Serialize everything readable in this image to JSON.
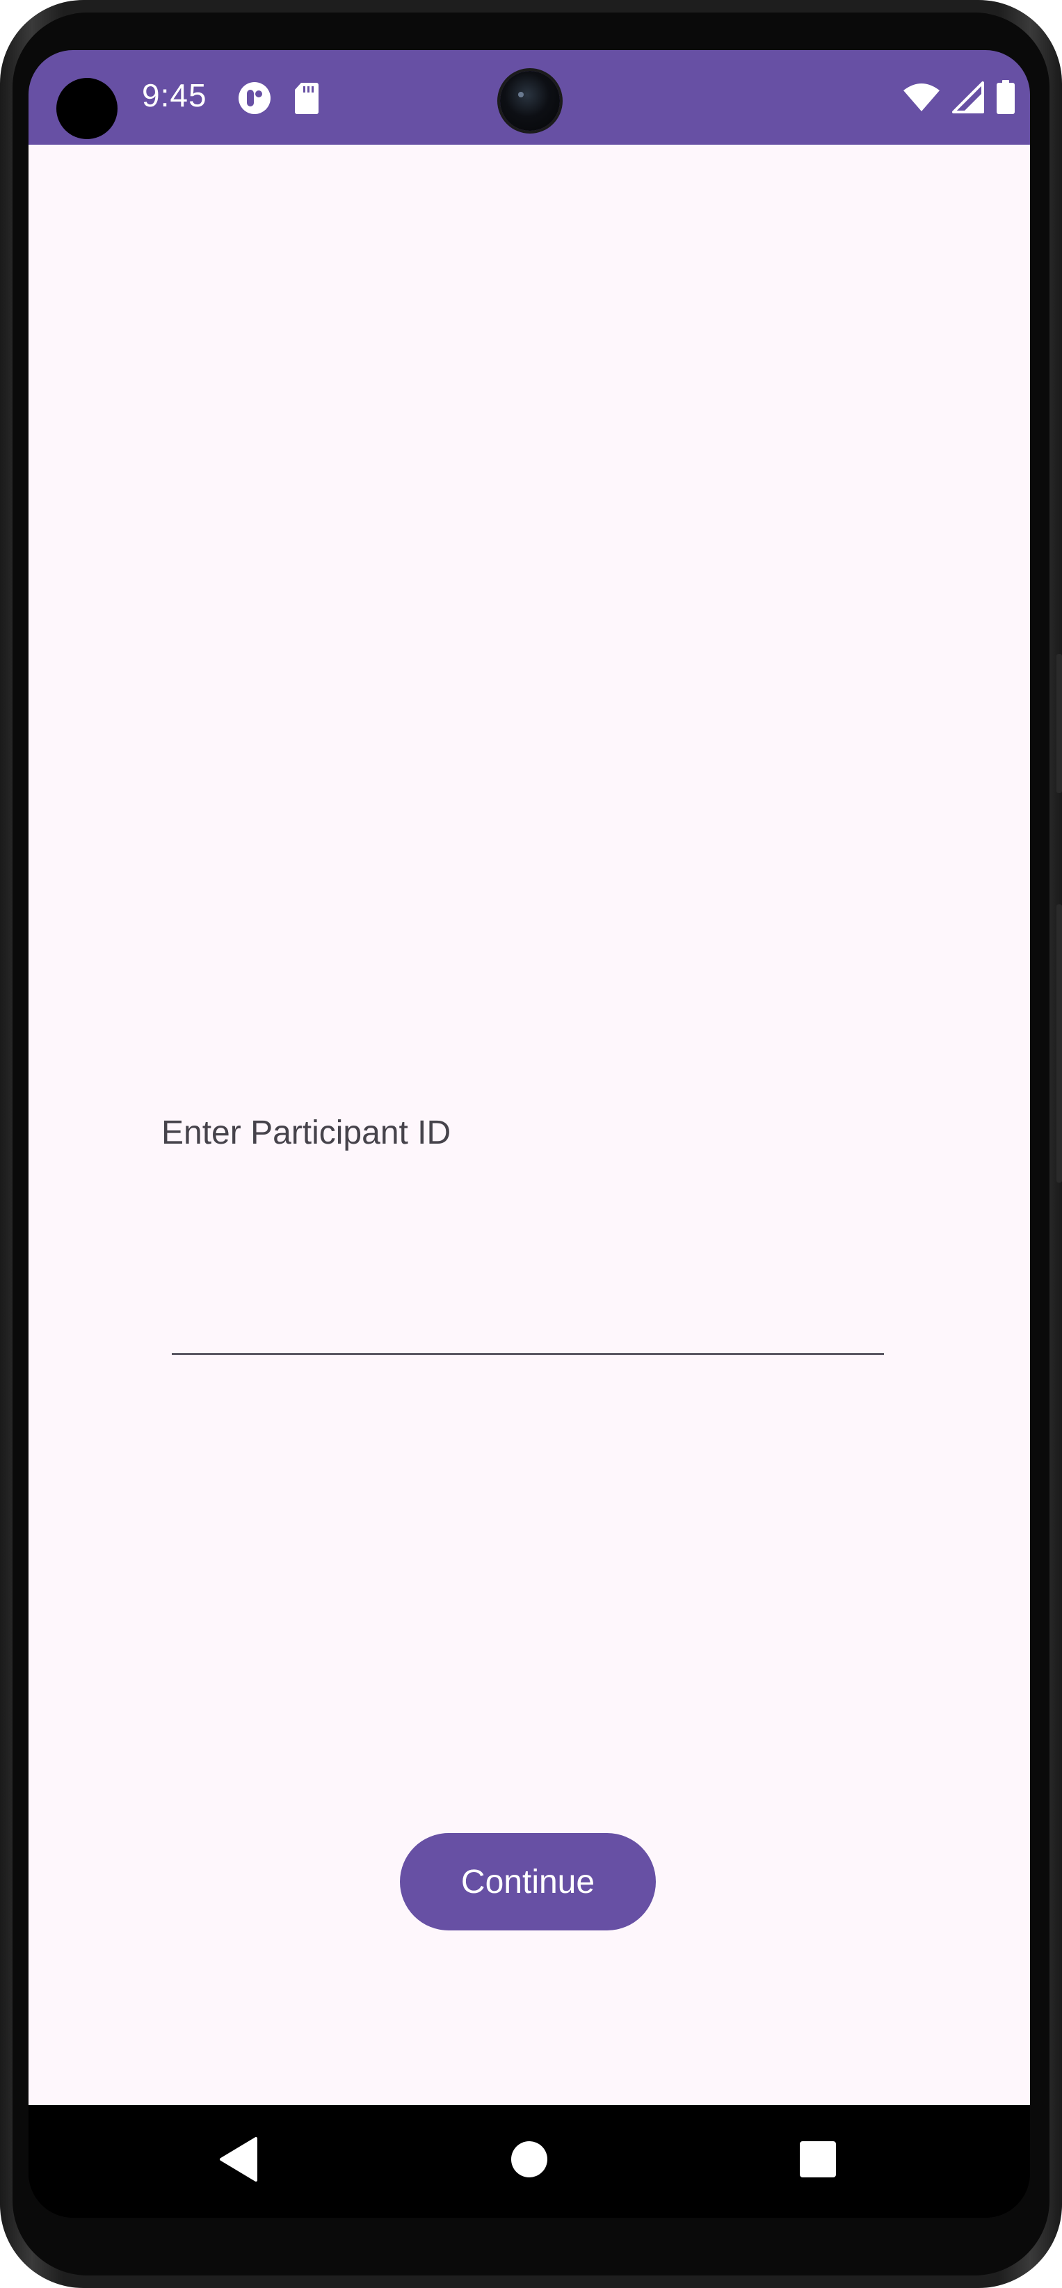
{
  "status_bar": {
    "time": "9:45",
    "background_color": "#6750a4",
    "left_icons": [
      "app-notification-icon",
      "sd-card-icon"
    ],
    "right_icons": [
      "wifi-icon",
      "cellular-signal-icon",
      "battery-icon"
    ]
  },
  "form": {
    "prompt_label": "Enter Participant ID",
    "participant_id_value": "",
    "participant_id_placeholder": "",
    "continue_label": "Continue"
  },
  "navigation_bar": {
    "buttons": [
      "back-icon",
      "home-icon",
      "recents-icon"
    ]
  },
  "colors": {
    "accent": "#6750a4",
    "surface": "#fef7fc",
    "on_surface_variant": "#46434b",
    "nav_bar": "#000000"
  }
}
